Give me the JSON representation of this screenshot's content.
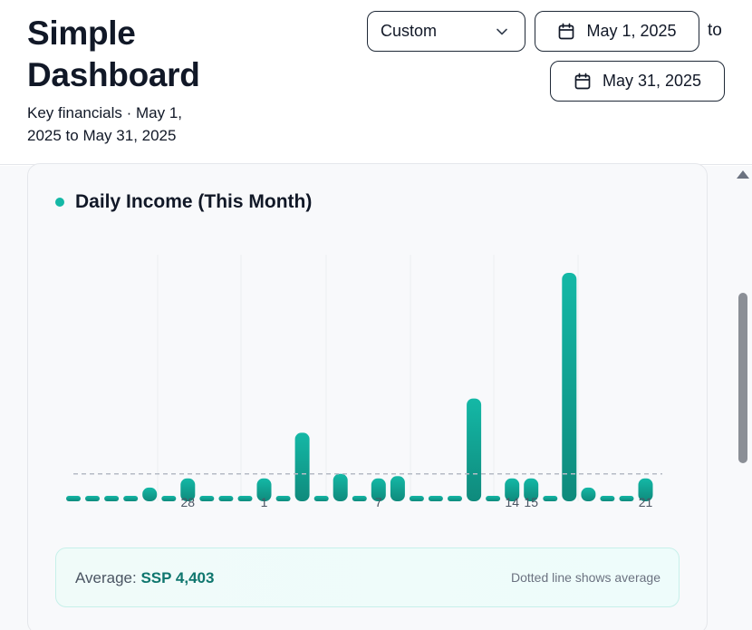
{
  "header": {
    "title": "Simple Dashboard",
    "subtitle": "Key financials · May 1, 2025 to May 31, 2025"
  },
  "controls": {
    "range_select": "Custom",
    "start_date": "May 1, 2025",
    "to_label": "to",
    "end_date": "May 31, 2025"
  },
  "card": {
    "title": "Daily Income (This Month)",
    "average_label": "Average:",
    "average_value": "SSP 4,403",
    "average_note": "Dotted line shows average"
  },
  "colors": {
    "accent": "#14b8a6",
    "accent_dark": "#0f8a7c",
    "avg_value": "#0f766e"
  },
  "chart_data": {
    "type": "bar",
    "tick_labels": [
      {
        "label": "28",
        "index": 6
      },
      {
        "label": "1",
        "index": 10
      },
      {
        "label": "7",
        "index": 16
      },
      {
        "label": "14",
        "index": 23
      },
      {
        "label": "15",
        "index": 24
      },
      {
        "label": "21",
        "index": 30
      }
    ],
    "values": [
      0.02,
      0.02,
      0.02,
      0.02,
      0.06,
      0.02,
      0.1,
      0.02,
      0.02,
      0.02,
      0.1,
      0.02,
      0.3,
      0.02,
      0.12,
      0.02,
      0.1,
      0.11,
      0.02,
      0.02,
      0.02,
      0.45,
      0.02,
      0.1,
      0.1,
      0.02,
      1.0,
      0.06,
      0.02,
      0.02,
      0.1
    ],
    "average": 0.12,
    "grid_x": true
  }
}
